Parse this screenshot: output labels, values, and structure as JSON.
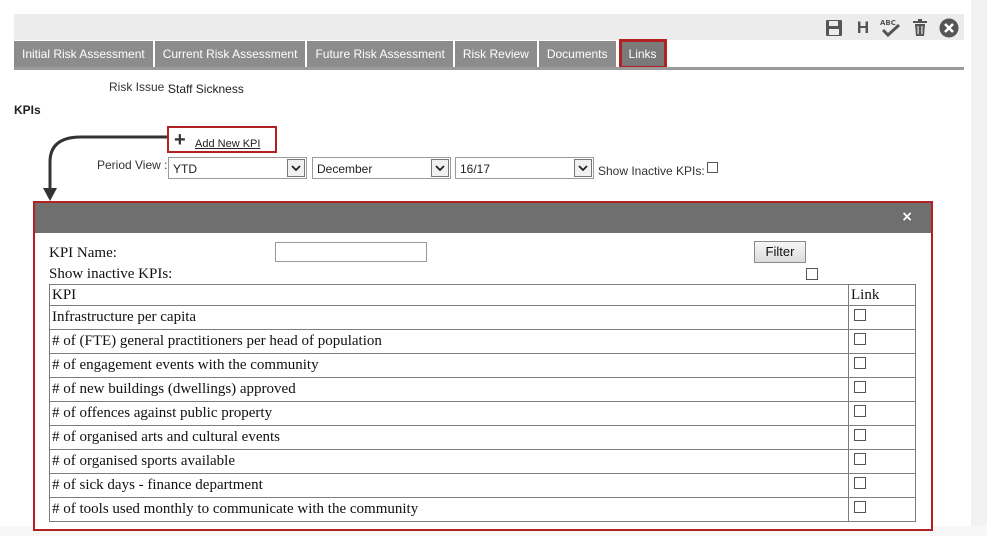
{
  "toolbar": {
    "icons": [
      "save-icon",
      "history-icon",
      "spellcheck-icon",
      "delete-icon",
      "close-icon"
    ],
    "history_label": "H"
  },
  "tabs": [
    {
      "label": "Initial Risk Assessment",
      "active": false
    },
    {
      "label": "Current Risk Assessment",
      "active": false
    },
    {
      "label": "Future Risk Assessment",
      "active": false
    },
    {
      "label": "Risk Review",
      "active": false
    },
    {
      "label": "Documents",
      "active": false
    },
    {
      "label": "Links",
      "active": true
    }
  ],
  "risk_issue": {
    "label": "Risk Issue :",
    "value": "Staff Sickness"
  },
  "kpis_heading": "KPIs",
  "add_new_kpi": {
    "icon": "plus-icon",
    "label": "Add New KPI"
  },
  "period_view": {
    "label": "Period View :",
    "period": "YTD",
    "month": "December",
    "year": "16/17",
    "show_inactive_label": "Show Inactive KPIs:",
    "show_inactive_checked": false
  },
  "modal": {
    "close_label": "×",
    "kpi_name_label": "KPI Name:",
    "kpi_name_value": "",
    "filter_label": "Filter",
    "show_inactive_label": "Show inactive KPIs:",
    "show_inactive_checked": false,
    "table": {
      "headers": [
        "KPI",
        "Link"
      ],
      "rows": [
        {
          "kpi": "Infrastructure per capita",
          "linked": false
        },
        {
          "kpi": "# of (FTE) general practitioners per head of population",
          "linked": false
        },
        {
          "kpi": "# of engagement events with the community",
          "linked": false
        },
        {
          "kpi": "# of new buildings (dwellings) approved",
          "linked": false
        },
        {
          "kpi": "# of offences against public property",
          "linked": false
        },
        {
          "kpi": "# of organised arts and cultural events",
          "linked": false
        },
        {
          "kpi": "# of organised sports available",
          "linked": false
        },
        {
          "kpi": "# of sick days - finance department",
          "linked": false
        },
        {
          "kpi": "# of tools used monthly to communicate with the community",
          "linked": false
        }
      ]
    }
  },
  "colors": {
    "highlight_border": "#b22222",
    "tab_bg": "#8c8c8c",
    "modal_header": "#6f6f6f"
  }
}
